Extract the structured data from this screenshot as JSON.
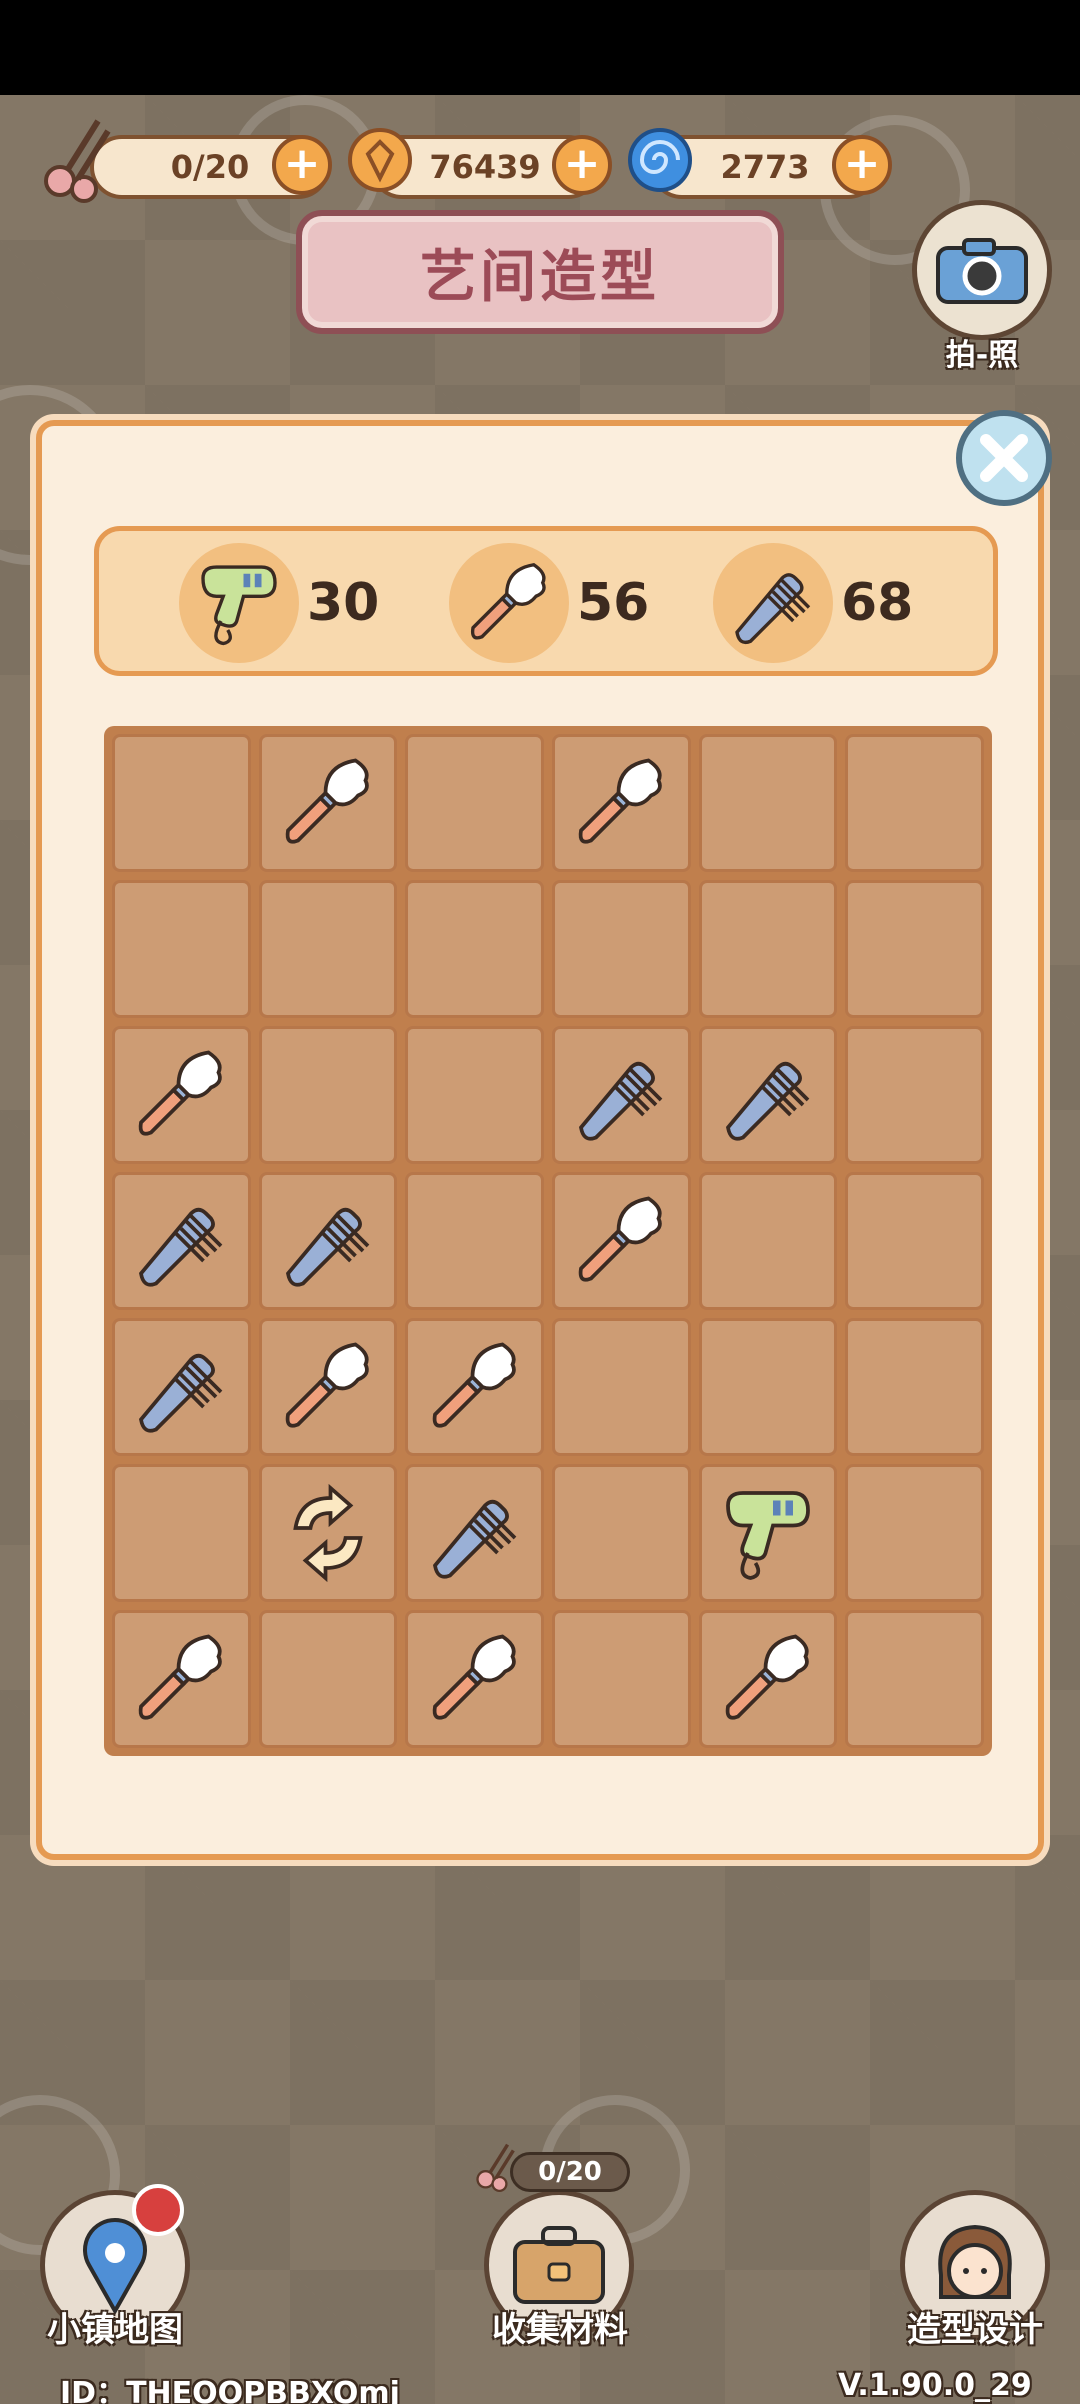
{
  "top_bar": {
    "energy": {
      "value": "0/20",
      "icon": "scissors-icon"
    },
    "coins": {
      "value": "76439",
      "icon": "coin-icon"
    },
    "gems": {
      "value": "2773",
      "icon": "swirl-gem-icon"
    },
    "plus_label": "+"
  },
  "title": "艺间造型",
  "camera": {
    "label": "拍-照",
    "icon": "camera-icon"
  },
  "counters": [
    {
      "icon": "hair-dryer-icon",
      "value": "30"
    },
    {
      "icon": "makeup-brush-icon",
      "value": "56"
    },
    {
      "icon": "comb-icon",
      "value": "68"
    }
  ],
  "board": {
    "rows": [
      [
        "",
        "brush",
        "",
        "brush",
        "",
        ""
      ],
      [
        "",
        "",
        "",
        "",
        "",
        ""
      ],
      [
        "brush",
        "",
        "",
        "comb",
        "comb",
        ""
      ],
      [
        "comb",
        "comb",
        "",
        "brush",
        "",
        ""
      ],
      [
        "comb",
        "brush",
        "brush",
        "",
        "",
        ""
      ],
      [
        "",
        "refresh",
        "comb",
        "",
        "dryer",
        ""
      ],
      [
        "brush",
        "",
        "brush",
        "",
        "brush",
        ""
      ]
    ]
  },
  "bottom_nav": {
    "map_label": "小镇地图",
    "collect_label": "收集材料",
    "collect_count": "0/20",
    "design_label": "造型设计"
  },
  "footer": {
    "id": "ID：THEOOPBBXOmj",
    "version": "V.1.90.0_29"
  },
  "colors": {
    "panel_bg": "#fbeedd",
    "panel_border": "#e59a52",
    "board_bg": "#c07f4d",
    "cell_bg": "#cd9c74",
    "plus_orange": "#f3a84c"
  }
}
